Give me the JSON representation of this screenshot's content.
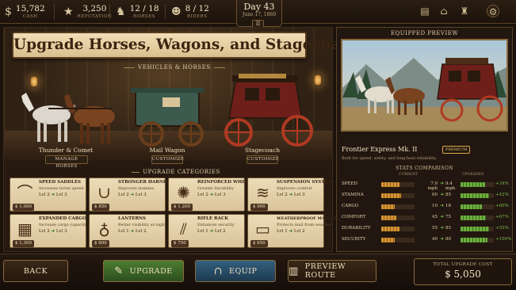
{
  "topbar": {
    "cash": {
      "value": "15,782",
      "label": "Cash",
      "icon": "dollar-icon"
    },
    "reputation": {
      "value": "3,250",
      "label": "Reputation",
      "icon": "star-icon"
    },
    "horses": {
      "value": "12 / 18",
      "label": "Horses",
      "icon": "horse-icon"
    },
    "riders": {
      "value": "8 / 12",
      "label": "Riders",
      "icon": "rider-icon"
    },
    "day": "Day 43",
    "date": "June 17, 1860",
    "pause_label": "II",
    "icons": [
      "book-icon",
      "town-icon",
      "hat-icon",
      "gear-icon"
    ]
  },
  "title": "Upgrade Horses, Wagons, and Stagecoaches",
  "vehicles": {
    "label": "Vehicles & Horses",
    "items": [
      {
        "name": "Thunder & Comet",
        "button": "Manage Horses"
      },
      {
        "name": "Mail Wagon",
        "button": "Customize"
      },
      {
        "name": "Stagecoach",
        "button": "Customize"
      }
    ]
  },
  "categories": {
    "label": "Upgrade Categories",
    "items": [
      {
        "name": "Speed Saddles",
        "desc": "Increases horse speed",
        "from": "Lvl 2",
        "to": "Lvl 3",
        "cost": "$ 1,000",
        "icon": "saddle-icon"
      },
      {
        "name": "Stronger Harnesses",
        "desc": "Improves stamina",
        "from": "Lvl 2",
        "to": "Lvl 3",
        "cost": "$ 850",
        "icon": "harness-icon"
      },
      {
        "name": "Reinforced Wheels",
        "desc": "Greater durability",
        "from": "Lvl 2",
        "to": "Lvl 3",
        "cost": "$ 1,200",
        "icon": "wheel-icon"
      },
      {
        "name": "Suspension System",
        "desc": "Improves comfort",
        "from": "Lvl 2",
        "to": "Lvl 3",
        "cost": "$ 900",
        "icon": "spring-icon"
      },
      {
        "name": "Expanded Cargo",
        "desc": "Increase cargo capacity",
        "from": "Lvl 2",
        "to": "Lvl 3",
        "cost": "$ 1,300",
        "icon": "crate-icon"
      },
      {
        "name": "Lanterns",
        "desc": "Better visibility at night",
        "from": "Lvl 1",
        "to": "Lvl 2",
        "cost": "$ 600",
        "icon": "lantern-icon"
      },
      {
        "name": "Rifle Rack",
        "desc": "Enhances security",
        "from": "Lvl 1",
        "to": "Lvl 2",
        "cost": "$ 750",
        "icon": "rifle-icon"
      },
      {
        "name": "Weatherproof Mail Trunk",
        "desc": "Protects mail from weather",
        "from": "Lvl 1",
        "to": "Lvl 2",
        "cost": "$ 650",
        "icon": "trunk-icon"
      }
    ]
  },
  "preview": {
    "label": "Equipped Preview",
    "name": "Frontier Express Mk. II",
    "badge": "Premium",
    "desc": "Built for speed, safety, and long-haul reliability."
  },
  "stats": {
    "label": "Stats Comparison",
    "col_current": "Current",
    "col_upgraded": "Upgraded",
    "rows": [
      {
        "name": "Speed",
        "current": "7.0 mph",
        "upgraded": "9.4 mph",
        "delta": "+34%",
        "cur_frac": 0.55,
        "up_frac": 0.74
      },
      {
        "name": "Stamina",
        "current": "60",
        "upgraded": "85",
        "delta": "+42%",
        "cur_frac": 0.6,
        "up_frac": 0.85
      },
      {
        "name": "Cargo",
        "current": "10",
        "upgraded": "16",
        "delta": "+60%",
        "cur_frac": 0.4,
        "up_frac": 0.64
      },
      {
        "name": "Comfort",
        "current": "45",
        "upgraded": "75",
        "delta": "+67%",
        "cur_frac": 0.45,
        "up_frac": 0.75
      },
      {
        "name": "Durability",
        "current": "55",
        "upgraded": "85",
        "delta": "+55%",
        "cur_frac": 0.55,
        "up_frac": 0.85
      },
      {
        "name": "Security",
        "current": "40",
        "upgraded": "80",
        "delta": "+100%",
        "cur_frac": 0.4,
        "up_frac": 0.8
      }
    ]
  },
  "bottom": {
    "back": "Back",
    "upgrade": "Upgrade",
    "equip": "Equip",
    "preview_route": "Preview Route",
    "total_label": "Total Upgrade Cost",
    "total_value": "$ 5,050"
  },
  "colors": {
    "upgrade_button": "#3f6a2a",
    "equip_button": "#2a4f6a",
    "accent_gold": "#d9a94a",
    "bar_current": "#d59432",
    "bar_upgraded": "#6cae3e"
  }
}
